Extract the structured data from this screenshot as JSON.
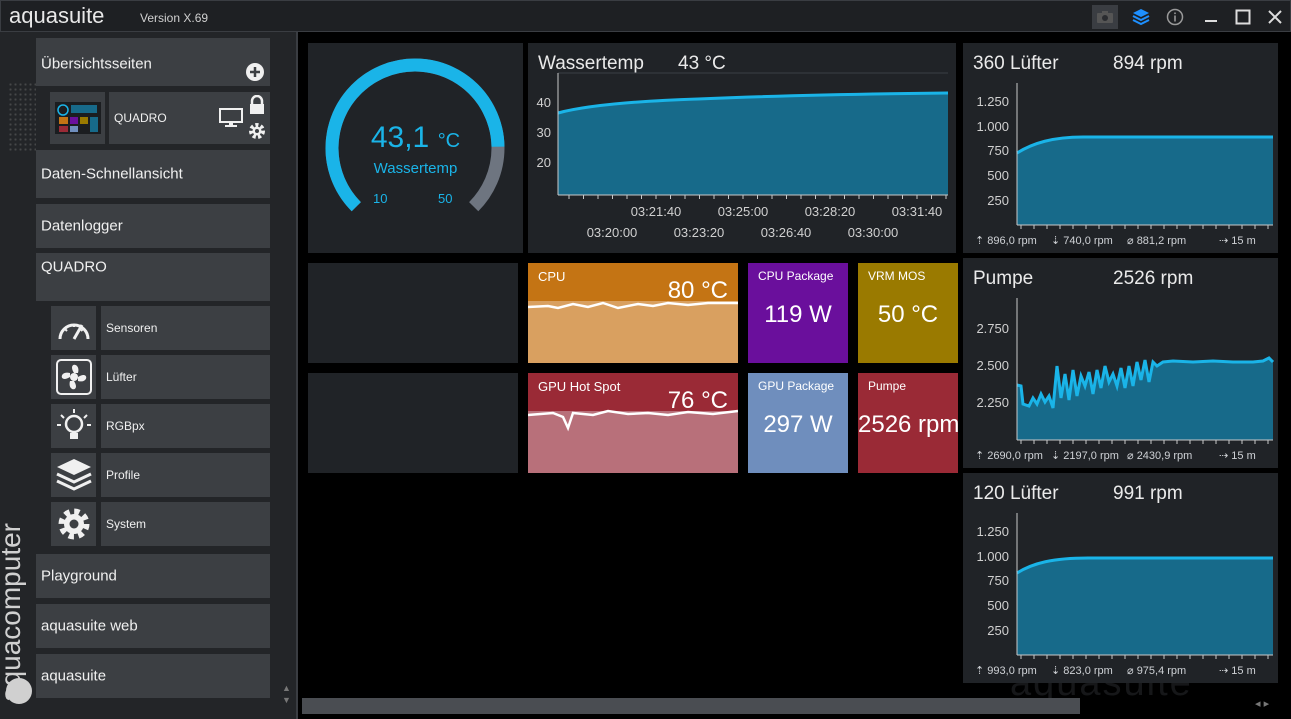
{
  "app": {
    "title": "aquasuite",
    "version": "Version X.69",
    "brand_vertical": "aquacomputer",
    "watermark": "aquasuite"
  },
  "titlebar_icons": [
    "camera-icon",
    "layers-icon",
    "info-icon",
    "minimize-icon",
    "maximize-icon",
    "close-icon"
  ],
  "sidebar": {
    "overview": "Übersichtsseiten",
    "quadro_page": "QUADRO",
    "quick_view": "Daten-Schnellansicht",
    "datalogger": "Datenlogger",
    "device": "QUADRO",
    "device_items": [
      {
        "label": "Sensoren",
        "icon": "gauge-icon"
      },
      {
        "label": "Lüfter",
        "icon": "fan-icon"
      },
      {
        "label": "RGBpx",
        "icon": "bulb-icon"
      },
      {
        "label": "Profile",
        "icon": "layers-icon"
      },
      {
        "label": "System",
        "icon": "gear-icon"
      }
    ],
    "playground": "Playground",
    "web": "aquasuite web",
    "aquasuite": "aquasuite"
  },
  "gauge": {
    "value": "43,1",
    "unit": "°C",
    "label": "Wassertemp",
    "min": "10",
    "max": "50",
    "level": 0.83
  },
  "water_chart": {
    "title": "Wassertemp",
    "value": "43 °C",
    "yticks": [
      "40",
      "30",
      "20"
    ],
    "xticks_top": [
      "03:21:40",
      "03:25:00",
      "03:28:20",
      "03:31:40"
    ],
    "xticks_bottom": [
      "03:20:00",
      "03:23:20",
      "03:26:40",
      "03:30:00"
    ]
  },
  "metrics": {
    "cpu": {
      "name": "CPU",
      "value": "80 °C",
      "color": "#d9a060",
      "head": "#c47414"
    },
    "cpu_package": {
      "name": "CPU Package",
      "value": "119 W",
      "color": "#6a0f9c"
    },
    "vrm": {
      "name": "VRM MOS",
      "value": "50 °C",
      "color": "#9a7a00"
    },
    "gpu_hotspot": {
      "name": "GPU Hot Spot",
      "value": "76 °C",
      "color": "#b8707a",
      "head": "#9a2a36"
    },
    "gpu_package": {
      "name": "GPU Package",
      "value": "297 W",
      "color": "#6f8ebd"
    },
    "pump": {
      "name": "Pumpe",
      "value": "2526 rpm",
      "color": "#9a2a36"
    }
  },
  "fan_charts": [
    {
      "title": "360 Lüfter",
      "value": "894 rpm",
      "yticks": [
        "1.250",
        "1.000",
        "750",
        "500",
        "250"
      ],
      "footer": [
        "896,0 rpm",
        "740,0 rpm",
        "881,2 rpm",
        "15 m"
      ]
    },
    {
      "title": "Pumpe",
      "value": "2526 rpm",
      "yticks": [
        "2.750",
        "2.500",
        "2.250"
      ],
      "footer": [
        "2690,0 rpm",
        "2197,0 rpm",
        "2430,9 rpm",
        "15 m"
      ]
    },
    {
      "title": "120 Lüfter",
      "value": "991 rpm",
      "yticks": [
        "1.250",
        "1.000",
        "750",
        "500",
        "250"
      ],
      "footer": [
        "993,0 rpm",
        "823,0 rpm",
        "975,4 rpm",
        "15 m"
      ]
    }
  ],
  "colors": {
    "accent": "#1ab4e8",
    "fill": "#176a8a"
  }
}
